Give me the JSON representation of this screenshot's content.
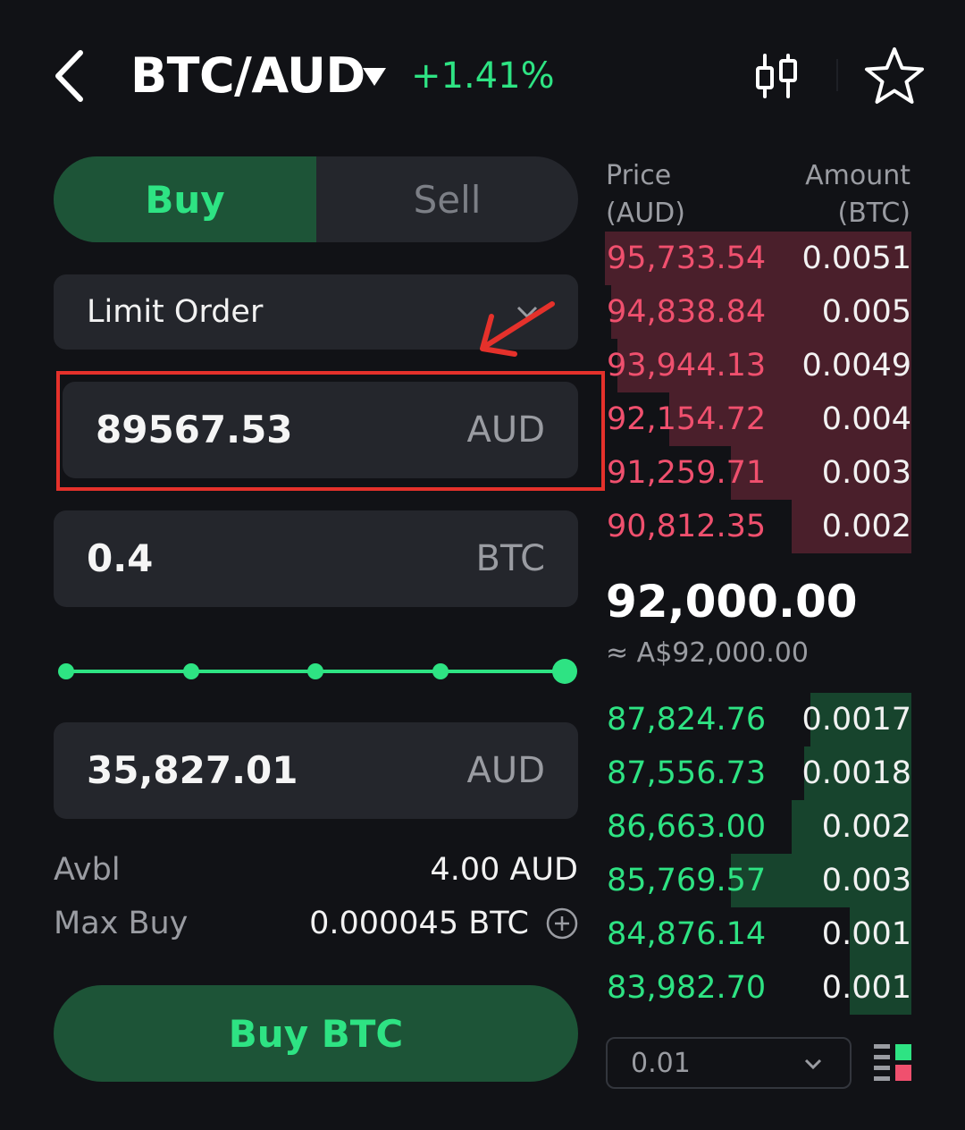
{
  "header": {
    "pair": "BTC/AUD",
    "change": "+1.41%"
  },
  "side_tabs": {
    "buy": "Buy",
    "sell": "Sell",
    "active": "Buy"
  },
  "order_type": {
    "label": "Limit Order"
  },
  "price_input": {
    "value": "89567.53",
    "unit": "AUD"
  },
  "amount_input": {
    "value": "0.4",
    "unit": "BTC"
  },
  "slider": {
    "level_percent": 100
  },
  "total_input": {
    "value": "35,827.01",
    "unit": "AUD"
  },
  "available": {
    "label": "Avbl",
    "value": "4.00 AUD"
  },
  "max_buy": {
    "label": "Max Buy",
    "value": "0.000045 BTC"
  },
  "submit": {
    "label": "Buy BTC"
  },
  "order_book": {
    "price_header": [
      "Price",
      "(AUD)"
    ],
    "amount_header": [
      "Amount",
      "(BTC)"
    ],
    "asks": [
      {
        "price": "95,733.54",
        "amount": "0.0051",
        "depth": 1.0
      },
      {
        "price": "94,838.84",
        "amount": "0.005",
        "depth": 0.98
      },
      {
        "price": "93,944.13",
        "amount": "0.0049",
        "depth": 0.96
      },
      {
        "price": "92,154.72",
        "amount": "0.004",
        "depth": 0.79
      },
      {
        "price": "91,259.71",
        "amount": "0.003",
        "depth": 0.59
      },
      {
        "price": "90,812.35",
        "amount": "0.002",
        "depth": 0.39
      }
    ],
    "mid_price": "92,000.00",
    "mid_fiat": "≈ A$92,000.00",
    "bids": [
      {
        "price": "87,824.76",
        "amount": "0.0017",
        "depth": 0.33
      },
      {
        "price": "87,556.73",
        "amount": "0.0018",
        "depth": 0.35
      },
      {
        "price": "86,663.00",
        "amount": "0.002",
        "depth": 0.39
      },
      {
        "price": "85,769.57",
        "amount": "0.003",
        "depth": 0.59
      },
      {
        "price": "84,876.14",
        "amount": "0.001",
        "depth": 0.2
      },
      {
        "price": "83,982.70",
        "amount": "0.001",
        "depth": 0.2
      }
    ],
    "precision": "0.01"
  },
  "colors": {
    "accent_green": "#2ee383",
    "ask_red": "#f0506e",
    "highlight_red": "#e5312b"
  },
  "icons": [
    "back-arrow-icon",
    "caret-down-icon",
    "kline-chart-icon",
    "star-icon",
    "chevron-down-icon",
    "plus-circle-icon",
    "book-layout-icon",
    "annotation-arrow-icon"
  ]
}
